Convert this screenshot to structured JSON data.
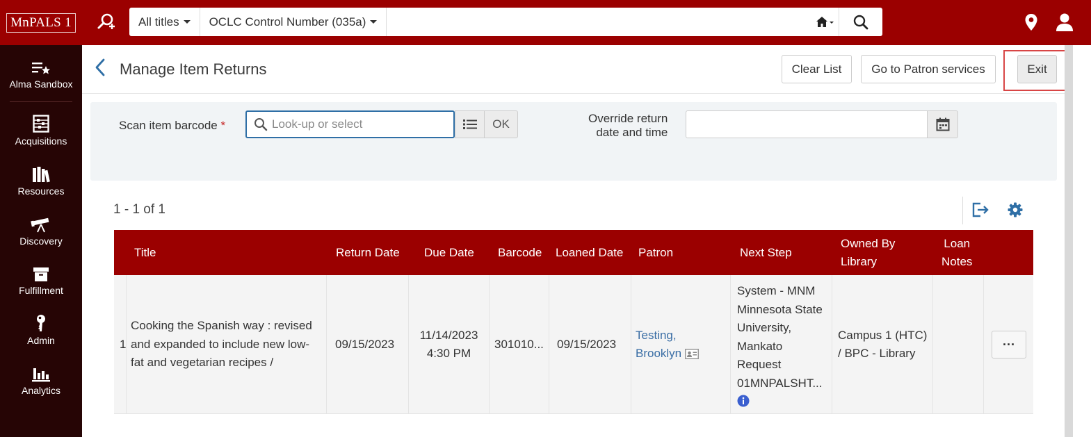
{
  "brand": {
    "logo_text": "MnPALS 1",
    "accent": "#9b0000",
    "nav_bg": "#260505"
  },
  "search": {
    "scope_label": "All titles",
    "field_label": "OCLC Control Number (035a)",
    "query_value": "",
    "icons": [
      "advanced-search-icon",
      "home-icon",
      "search-icon"
    ]
  },
  "topbar_icons": [
    "location-pin-icon",
    "user-icon"
  ],
  "sidebar": {
    "items": [
      {
        "label": "Alma Sandbox",
        "icon": "list-star-icon"
      },
      {
        "label": "Acquisitions",
        "icon": "abacus-icon"
      },
      {
        "label": "Resources",
        "icon": "books-icon"
      },
      {
        "label": "Discovery",
        "icon": "telescope-icon"
      },
      {
        "label": "Fulfillment",
        "icon": "archive-box-icon"
      },
      {
        "label": "Admin",
        "icon": "key-icon"
      },
      {
        "label": "Analytics",
        "icon": "bar-chart-icon"
      }
    ]
  },
  "page": {
    "title": "Manage Item Returns",
    "buttons": {
      "clear": "Clear List",
      "patron": "Go to Patron services",
      "exit": "Exit"
    }
  },
  "form": {
    "scan_label": "Scan item barcode",
    "required_mark": "*",
    "scan_placeholder": "Look-up or select",
    "scan_value": "",
    "ok_label": "OK",
    "override_label_1": "Override return",
    "override_label_2": "date and time",
    "override_value": ""
  },
  "results": {
    "count_text": "1 - 1 of 1"
  },
  "table": {
    "headers": {
      "title": "Title",
      "return_date": "Return Date",
      "due_date": "Due Date",
      "barcode": "Barcode",
      "loaned_date": "Loaned Date",
      "patron": "Patron",
      "next_step": "Next Step",
      "owned_by_1": "Owned By",
      "owned_by_2": "Library",
      "loan_notes_1": "Loan",
      "loan_notes_2": "Notes"
    },
    "rows": [
      {
        "index": "1",
        "title_1": "Cooking the Spanish way : revised",
        "title_2": "and expanded to include new low-",
        "title_3": "fat and vegetarian recipes /",
        "return_date": "09/15/2023",
        "due_date_1": "11/14/2023",
        "due_date_2": "4:30 PM",
        "barcode": "301010...",
        "loaned_date": "09/15/2023",
        "patron_1": "Testing,",
        "patron_2": "Brooklyn",
        "next_step_1": "System - MNM",
        "next_step_2": "Minnesota State",
        "next_step_3": "University,",
        "next_step_4": "Mankato",
        "next_step_5": "Request",
        "next_step_6": "01MNPALSHT...",
        "owned_1": "Campus 1 (HTC)",
        "owned_2": "/ BPC - Library",
        "loan_notes": "",
        "actions_label": "···"
      }
    ]
  }
}
